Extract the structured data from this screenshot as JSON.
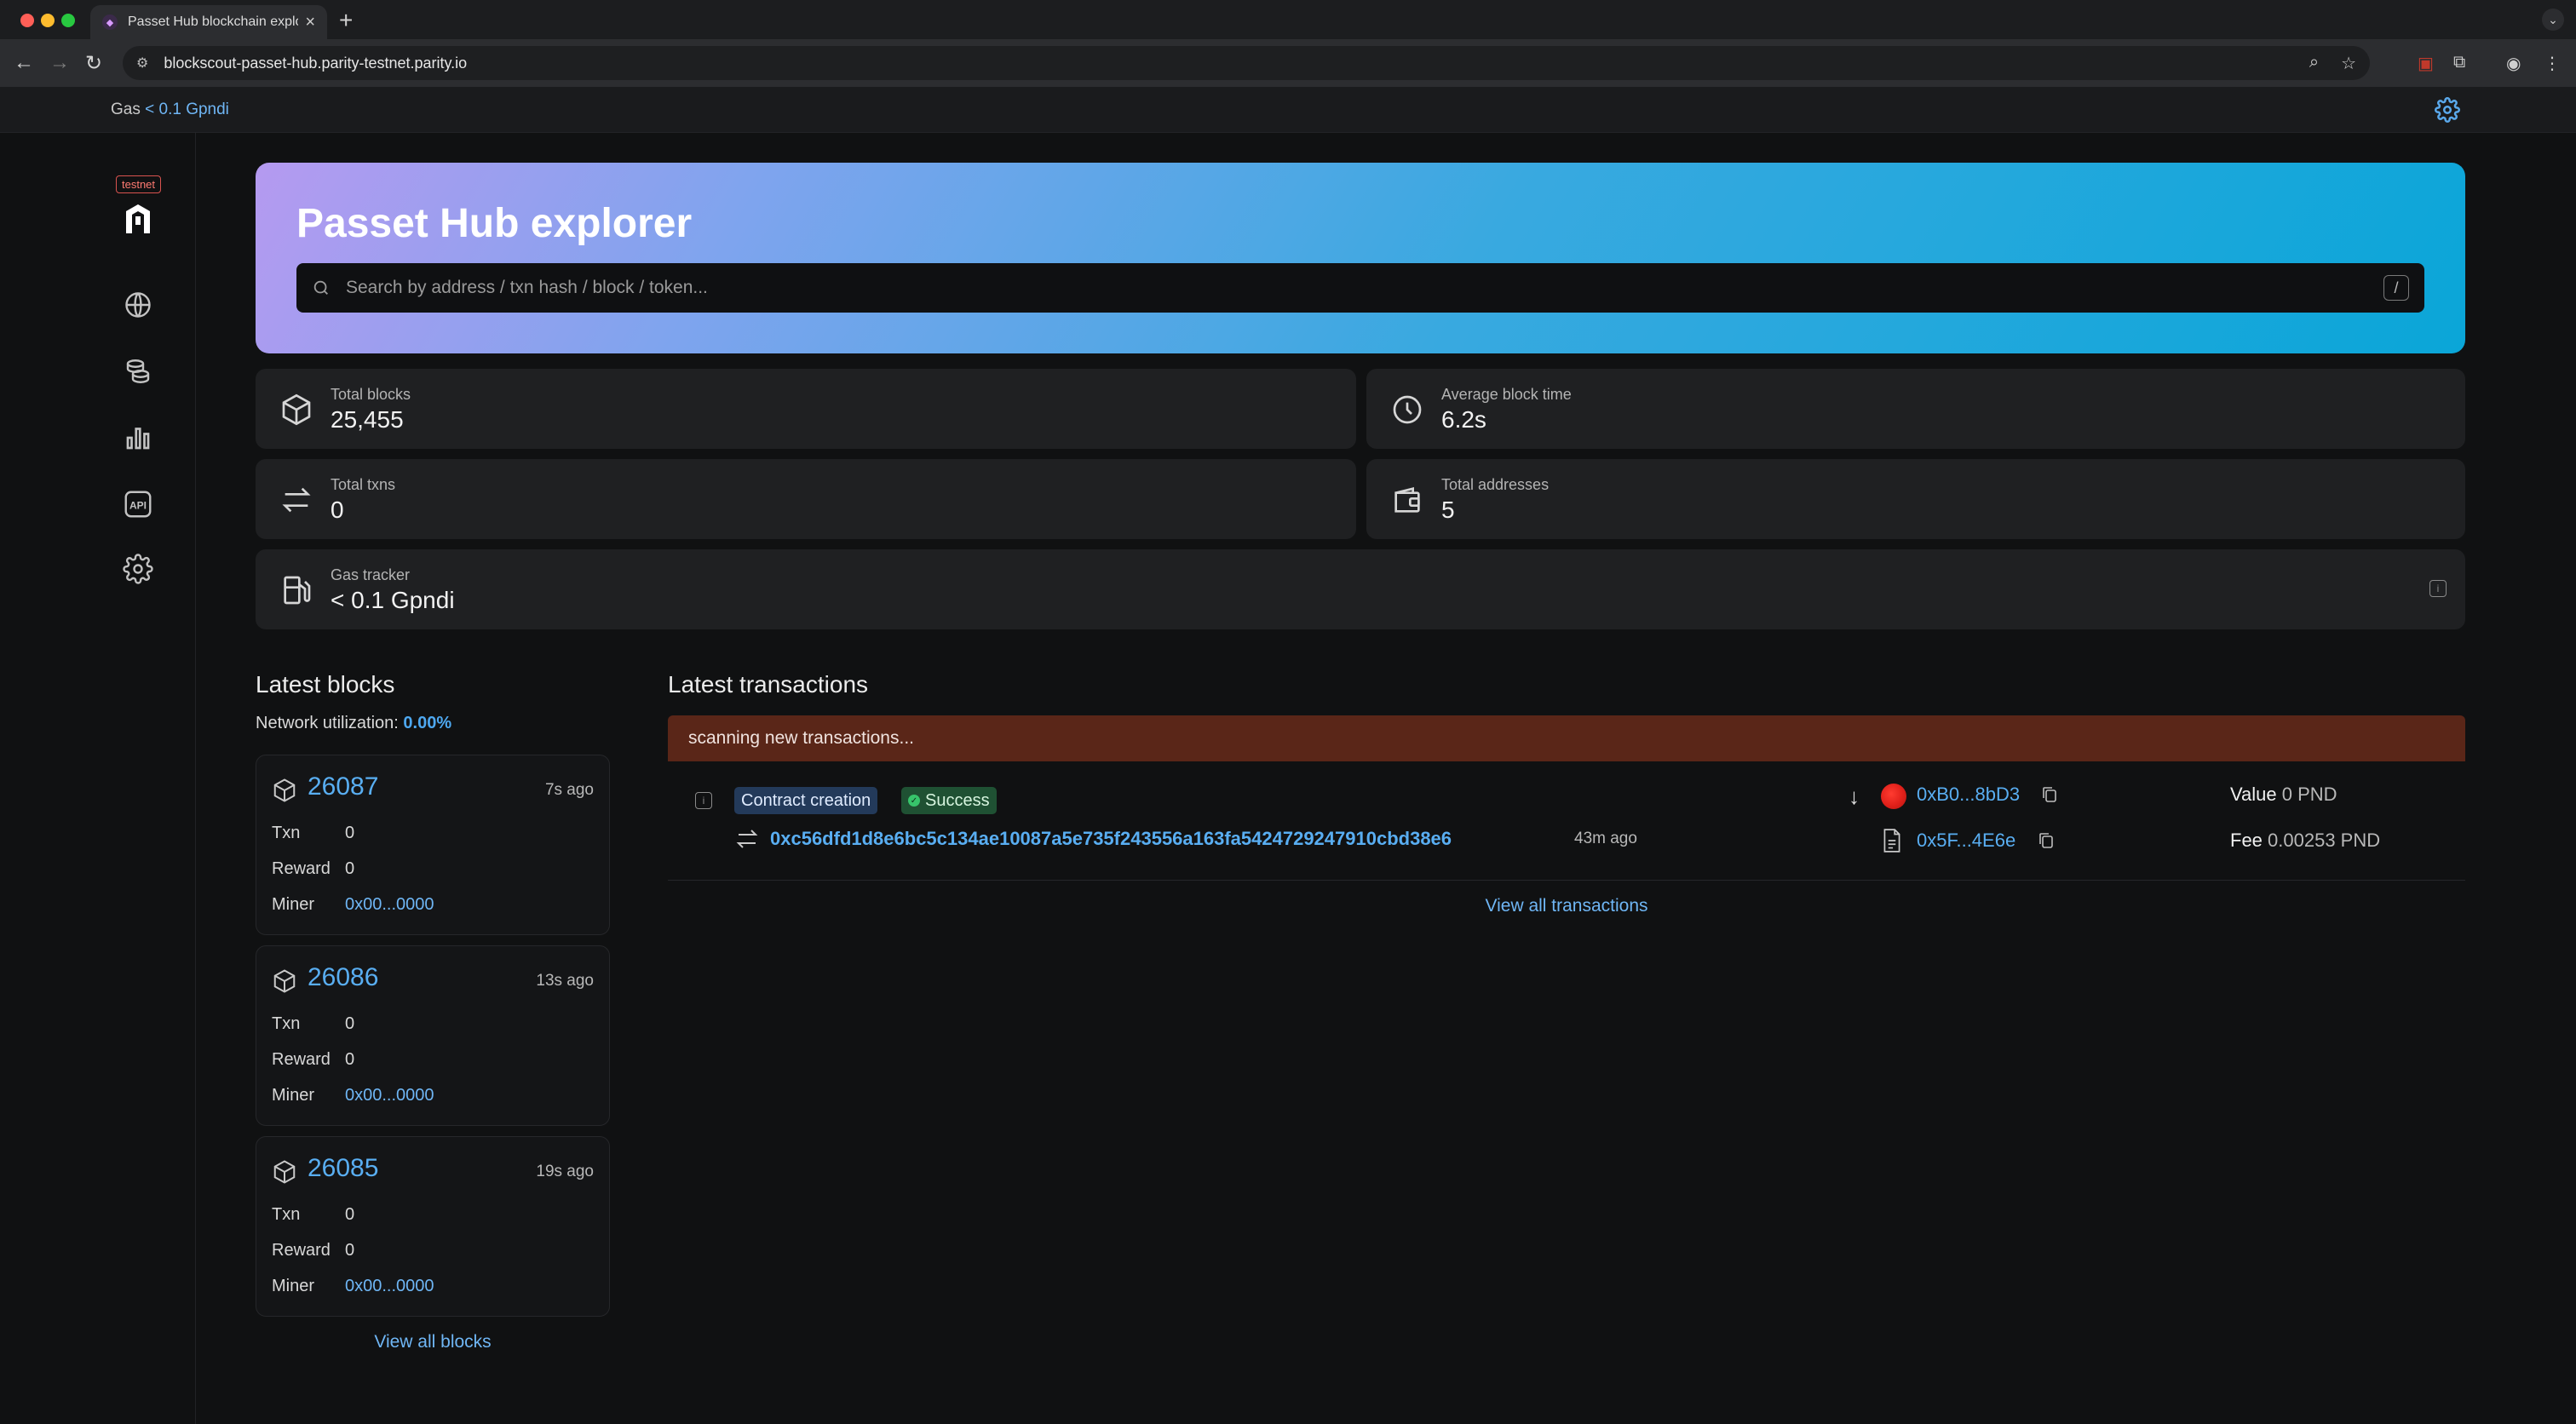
{
  "browser": {
    "tab_title": "Passet Hub blockchain explor",
    "url": "blockscout-passet-hub.parity-testnet.parity.io"
  },
  "topbar": {
    "gas_label": "Gas",
    "gas_value": "< 0.1 Gpndi"
  },
  "sidebar": {
    "badge": "testnet",
    "items": [
      {
        "icon": "globe-icon"
      },
      {
        "icon": "coins-icon"
      },
      {
        "icon": "bar-chart-icon"
      },
      {
        "icon": "api-icon",
        "label": "API"
      },
      {
        "icon": "gear-icon"
      }
    ]
  },
  "hero": {
    "title": "Passet Hub explorer",
    "search_placeholder": "Search by address / txn hash / block / token...",
    "shortcut": "/"
  },
  "stats": {
    "total_blocks": {
      "label": "Total blocks",
      "value": "25,455"
    },
    "avg_block_time": {
      "label": "Average block time",
      "value": "6.2s"
    },
    "total_txns": {
      "label": "Total txns",
      "value": "0"
    },
    "total_addresses": {
      "label": "Total addresses",
      "value": "5"
    },
    "gas_tracker": {
      "label": "Gas tracker",
      "value": "< 0.1 Gpndi"
    }
  },
  "latest_blocks": {
    "title": "Latest blocks",
    "net_util_label": "Network utilization:",
    "net_util_value": "0.00%",
    "row_labels": {
      "txn": "Txn",
      "reward": "Reward",
      "miner": "Miner"
    },
    "blocks": [
      {
        "number": "26087",
        "age": "7s ago",
        "txn": "0",
        "reward": "0",
        "miner": "0x00...0000"
      },
      {
        "number": "26086",
        "age": "13s ago",
        "txn": "0",
        "reward": "0",
        "miner": "0x00...0000"
      },
      {
        "number": "26085",
        "age": "19s ago",
        "txn": "0",
        "reward": "0",
        "miner": "0x00...0000"
      }
    ],
    "view_all": "View all blocks"
  },
  "latest_transactions": {
    "title": "Latest transactions",
    "scanning": "scanning new transactions...",
    "tx": {
      "type_tag": "Contract creation",
      "status_tag": "Success",
      "hash": "0xc56dfd1d8e6bc5c134ae10087a5e735f243556a163fa5424729247910cbd38e6",
      "age": "43m ago",
      "from": "0xB0...8bD3",
      "to": "0x5F...4E6e",
      "value_label": "Value",
      "value": "0 PND",
      "fee_label": "Fee",
      "fee": "0.00253 PND"
    },
    "view_all": "View all transactions"
  },
  "colors": {
    "accent_link": "#59aef2",
    "scan_banner": "#5a2618",
    "success_tag": "#1f5133",
    "contract_tag": "#233a5a"
  }
}
